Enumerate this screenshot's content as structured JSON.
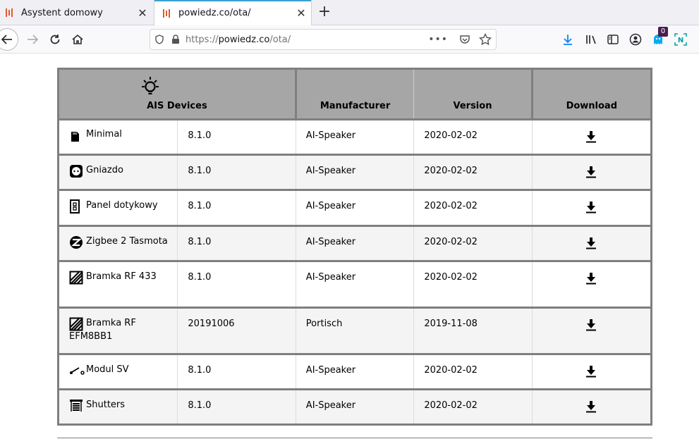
{
  "tabs": [
    {
      "title": "Asystent domowy",
      "active": false
    },
    {
      "title": "powiedz.co/ota/",
      "active": true
    }
  ],
  "new_tab_label": "+",
  "urlbar": {
    "prefix": "https://",
    "domain": "powiedz.co",
    "path": "/ota/"
  },
  "extension_badge": "0",
  "table": {
    "headers": [
      "AIS Devices",
      "Manufacturer",
      "Version",
      "Download"
    ],
    "rows": [
      {
        "device": "Minimal",
        "icon": "sd-card-icon",
        "version": "8.1.0",
        "manufacturer": "AI-Speaker",
        "date": "2020-02-02"
      },
      {
        "device": "Gniazdo",
        "icon": "power-socket-icon",
        "version": "8.1.0",
        "manufacturer": "AI-Speaker",
        "date": "2020-02-02"
      },
      {
        "device": "Panel dotykowy",
        "icon": "touch-panel-icon",
        "version": "8.1.0",
        "manufacturer": "AI-Speaker",
        "date": "2020-02-02"
      },
      {
        "device": "Zigbee 2 Tasmota",
        "icon": "zigbee-icon",
        "version": "8.1.0",
        "manufacturer": "AI-Speaker",
        "date": "2020-02-02"
      },
      {
        "device": "Bramka RF 433",
        "icon": "rf-bridge-icon",
        "version": "8.1.0",
        "manufacturer": "AI-Speaker",
        "date": "2020-02-02"
      },
      {
        "device": "Bramka RF EFM8BB1",
        "icon": "rf-bridge-icon",
        "version": "20191006",
        "manufacturer": "Portisch",
        "date": "2019-11-08"
      },
      {
        "device": "Modul SV",
        "icon": "switch-icon",
        "version": "8.1.0",
        "manufacturer": "AI-Speaker",
        "date": "2020-02-02"
      },
      {
        "device": "Shutters",
        "icon": "shutters-icon",
        "version": "8.1.0",
        "manufacturer": "AI-Speaker",
        "date": "2020-02-02"
      }
    ]
  },
  "colors": {
    "accent": "#3aa0d0",
    "header_bg": "#a6a6a6",
    "border": "#7f7f7f",
    "favicon": "#e05a2a",
    "download_arrow": "#0a84ff"
  }
}
